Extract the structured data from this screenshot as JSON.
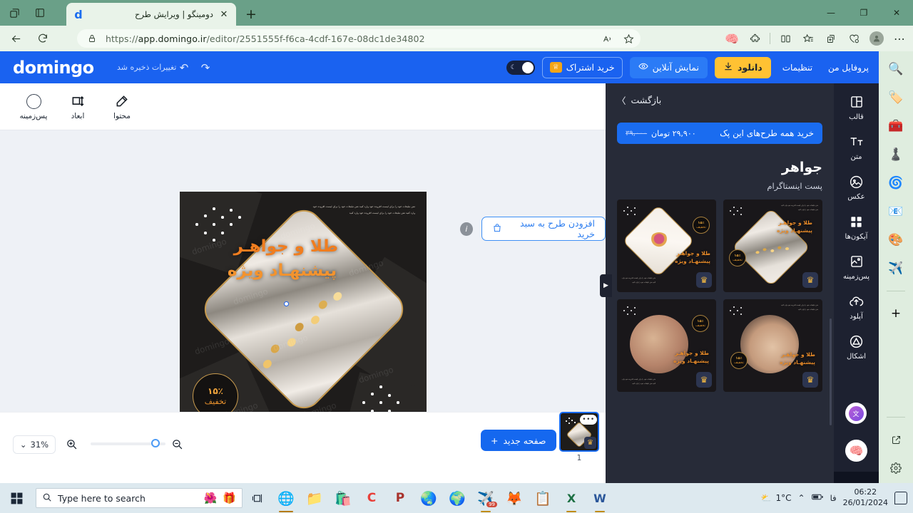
{
  "browser": {
    "tab_title": "دومینگو | ویرایش طرح",
    "tab_favicon": "d",
    "url_scheme": "https://",
    "url_main": "app.domingo.ir",
    "url_path": "/editor/2551555f-f6ca-4cdf-167e-08dc1de34802",
    "new_tab_label": "+",
    "close_tab_label": "✕",
    "minimize_label": "—",
    "maximize_label": "❐",
    "window_close_label": "✕",
    "back_label": "←",
    "refresh_label": "⟳",
    "lock_icon": "🔒",
    "read_aloud_label": "A",
    "favorite_label": "☆"
  },
  "edge_sidebar": {
    "items": [
      {
        "name": "search-icon",
        "glyph": "🔍"
      },
      {
        "name": "shopping-tag-icon",
        "glyph": "🏷"
      },
      {
        "name": "tools-briefcase-icon",
        "glyph": "🧰"
      },
      {
        "name": "games-icon",
        "glyph": "♟"
      },
      {
        "name": "microsoft-365-icon",
        "glyph": "🌀"
      },
      {
        "name": "outlook-icon",
        "glyph": "📧"
      },
      {
        "name": "designer-icon",
        "glyph": "🎨"
      },
      {
        "name": "telegram-icon",
        "glyph": "✈"
      }
    ],
    "add_label": "+",
    "open_external_label": "⧉",
    "settings_label": "⚙"
  },
  "app_header": {
    "logo": "domingo",
    "saved_status": "تغییرات ذخیره شد",
    "undo_label": "↶",
    "redo_label": "↷",
    "profile_label": "پروفایل من",
    "settings_label": "تنظیمات",
    "download_label": "دانلود",
    "download_icon": "⬇",
    "preview_label": "نمایش آنلاین",
    "preview_icon": "◎",
    "subscribe_label": "خرید اشتراک",
    "crown_icon": "♕",
    "theme_moon_icon": "☾",
    "accent_blue": "#1a62f0",
    "accent_yellow": "#ffc233"
  },
  "edit_toolbar": {
    "items": [
      {
        "label": "پس‌زمینه",
        "icon": "circle"
      },
      {
        "label": "ابعاد",
        "icon": "resize"
      },
      {
        "label": "محتوا",
        "icon": "pencil"
      }
    ]
  },
  "canvas": {
    "add_to_cart_label": "افزودن طرح به سبد خرید",
    "cart_icon": "🛍",
    "info_icon": "i",
    "design": {
      "title_line1": "طلا و جواهـر",
      "title_line2": "پیشنهـاد ویژه",
      "badge_percent": "۱۵٪",
      "badge_label": "تخفیف",
      "body_text": "متن تبلیغات خود را برای لیست افزوده خود وارد کنید متن تبلیغات خود را برای لیست افزوده خود وارد کنید متن تبلیغات خود را برای لیست افزوده خود وارد کنید",
      "watermark": "domingo"
    },
    "magic_icon": "✨",
    "collapse_icon": "⌄",
    "panel_toggle_icon": "▶"
  },
  "bottom_bar": {
    "zoom_value": "31%",
    "zoom_chevron": "⌄",
    "zoom_in_icon": "＋",
    "zoom_out_icon": "－",
    "new_page_label": "صفحه جدید",
    "new_page_icon": "+",
    "page_number": "1",
    "page_menu_icon": "•••",
    "page_crown_icon": "♛"
  },
  "side_panel": {
    "back_label": "بازگشت",
    "back_chevron": "〉",
    "pack_button_label": "خرید همه طرح‌های این پک",
    "price_new": "۲۹,۹۰۰ تومان",
    "price_old": "۳۹,۰۰۰",
    "title": "جواهر",
    "subtitle": "پست اینستاگرام",
    "thumbnails": [
      {
        "title": "طلا و جواهـر",
        "subtitle": "پیشنهـاد ویژه",
        "badge_percent": "۱۵٪",
        "badge_label": "تخفیف",
        "crown_icon": "♛"
      },
      {
        "title": "طلا و جواهـر",
        "subtitle": "پیشنهـاد ویژه",
        "badge_percent": "۱۵٪",
        "badge_label": "تخفیف",
        "crown_icon": "♛"
      },
      {
        "title": "طلا و جواهـر",
        "subtitle": "پیشنهـاد ویژه",
        "badge_percent": "۱۵٪",
        "badge_label": "تخفیف",
        "crown_icon": "♛"
      },
      {
        "title": "طلا و جواهـر",
        "subtitle": "پیشنهـاد ویژه",
        "badge_percent": "۱۵٪",
        "badge_label": "تخفیف",
        "crown_icon": "♛"
      }
    ],
    "micro_text": "متن تبلیغات خود را برای لیست افزوده خود وارد کنید متن تبلیغات خود را وارد کنید"
  },
  "tool_rail": {
    "items": [
      {
        "label": "قالب",
        "icon": "template"
      },
      {
        "label": "متن",
        "icon": "text"
      },
      {
        "label": "عکس",
        "icon": "image"
      },
      {
        "label": "آیکون‌ها",
        "icon": "grid"
      },
      {
        "label": "پس‌زمینه",
        "icon": "background"
      },
      {
        "label": "آپلود",
        "icon": "upload"
      },
      {
        "label": "اشکال",
        "icon": "shapes"
      }
    ],
    "fab_translate_icon": "文",
    "fab_ai_icon": "🧠"
  },
  "taskbar": {
    "start_label": "⊞",
    "search_placeholder": "Type here to search",
    "search_icon": "🔍",
    "gift_icon": "🎁",
    "flower_icon": "🌺",
    "task_view_icon": "❏",
    "apps": [
      {
        "name": "edge-icon",
        "glyph": "🌐"
      },
      {
        "name": "file-explorer-icon",
        "glyph": "📁"
      },
      {
        "name": "microsoft-store-icon",
        "glyph": "🛍"
      },
      {
        "name": "c-app-icon",
        "glyph": "C"
      },
      {
        "name": "p-app-icon",
        "glyph": "P"
      },
      {
        "name": "chrome-icon",
        "glyph": "🌏"
      },
      {
        "name": "internet-download-manager-icon",
        "glyph": "🌍"
      },
      {
        "name": "telegram-icon",
        "glyph": "✈",
        "badge": "99"
      },
      {
        "name": "firefox-icon",
        "glyph": "🦊"
      },
      {
        "name": "notes-icon",
        "glyph": "📋"
      },
      {
        "name": "excel-icon",
        "glyph": "X"
      },
      {
        "name": "word-icon",
        "glyph": "W"
      }
    ],
    "weather_temp": "1°C",
    "weather_icon": "⛅",
    "chevron_up": "⌃",
    "battery_icon": "🔋",
    "language": "فا",
    "time": "06:22",
    "date": "26/01/2024"
  }
}
